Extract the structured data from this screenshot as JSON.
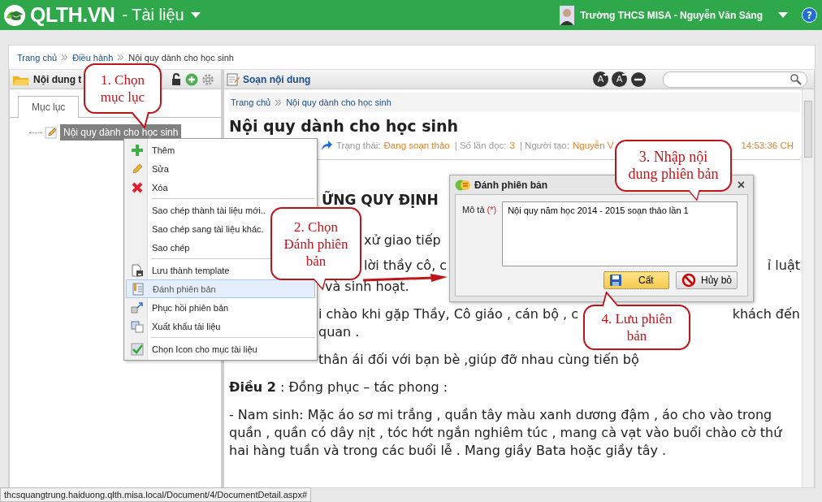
{
  "header": {
    "logo": "QLTH.VN",
    "module": "- Tài liệu",
    "user": "Trường THCS MISA - Nguyễn Văn Sáng",
    "help": "?"
  },
  "breadcrumb": [
    "Trang chủ",
    "Điều hành",
    "Nội quy dành cho học sinh"
  ],
  "left_panel": {
    "title": "Nội dung t",
    "tabs": [
      {
        "label": "Mục lục",
        "selected": true
      }
    ],
    "tree": [
      {
        "label": "Nội quy dành cho học sinh",
        "selected": true
      }
    ]
  },
  "toolbar": {
    "title": "Soạn nội dung",
    "font_buttons": [
      {
        "label": "A",
        "kind": "increase"
      },
      {
        "label": "A",
        "kind": "decrease"
      }
    ]
  },
  "document": {
    "breadcrumb": [
      "Trang chủ",
      "Nội quy dành cho học sinh"
    ],
    "title": "Nội quy dành cho học sinh",
    "meta": [
      {
        "label": "Trạng thái:",
        "value": "Đang soạn thảo"
      },
      {
        "label": "| Số lần đọc:",
        "value": "3"
      },
      {
        "label": "| Người tạo:",
        "value": "Nguyễn V"
      }
    ],
    "meta_time": "14:53:36 CH",
    "lines": [
      {
        "kind": "heading",
        "segments": [
          "ỮNG QUY ĐỊNH"
        ]
      },
      {
        "kind": "para",
        "segments": [
          "xử giao tiếp"
        ]
      },
      {
        "kind": "para",
        "segments": [
          "lời thầy cô, c",
          "ỉ luật"
        ]
      },
      {
        "kind": "cont",
        "segments": [
          "và sinh hoạt."
        ]
      },
      {
        "kind": "para",
        "segments": [
          "i chào khi gặp Thầy, Cô giáo , cán bộ , c",
          "khách đến"
        ]
      },
      {
        "kind": "cont",
        "segments": [
          "quan ."
        ]
      },
      {
        "kind": "para",
        "segments": [
          "thân ái đối với bạn bè ,giúp đỡ nhau cùng tiến bộ"
        ]
      },
      {
        "kind": "para",
        "segments": [
          "**Điều 2** : Đồng phục – tác phong :"
        ]
      },
      {
        "kind": "para",
        "segments": [
          "- Nam sinh:  Mặc áo sơ mi trắng , quần tây màu xanh dương đậm , áo cho vào trong quần , quần có dây nịt , tóc hớt ngắn nghiêm túc , mang cà vạt vào buổi chào cờ thứ hai hàng tuần và trong các buổi lễ . Mang giầy Bata hoặc giầy tây ."
        ]
      }
    ]
  },
  "context_menu": [
    {
      "label": "Thêm",
      "kind": "plus",
      "divider_before": false,
      "selected": false
    },
    {
      "label": "Sửa",
      "kind": "pencil",
      "divider_before": false,
      "selected": false
    },
    {
      "label": "Xóa",
      "kind": "cross",
      "divider_before": false,
      "selected": false
    },
    {
      "label": "Sao chép thành tài liệu mới..",
      "kind": "text",
      "divider_before": true,
      "selected": false
    },
    {
      "label": "Sao chép sang tài liệu khác.",
      "kind": "text",
      "divider_before": false,
      "selected": false
    },
    {
      "label": "Sao chép",
      "kind": "text",
      "divider_before": false,
      "selected": false
    },
    {
      "label": "Lưu thành template",
      "kind": "save",
      "divider_before": true,
      "selected": false
    },
    {
      "label": "Đánh phiên bản",
      "kind": "book",
      "divider_before": false,
      "selected": true
    },
    {
      "label": "Phục hồi phiên bản",
      "kind": "restore",
      "divider_before": false,
      "selected": false
    },
    {
      "label": "Xuất khẩu tài liệu",
      "kind": "export",
      "divider_before": false,
      "selected": false
    },
    {
      "label": "Chọn Icon cho mục tài liệu",
      "kind": "check",
      "divider_before": true,
      "selected": false
    }
  ],
  "dialog": {
    "title": "Đánh phiên bản",
    "close": "×",
    "field_label": "Mô tả",
    "required": "(*)",
    "value": "Nội quy năm học 2014 - 2015 soạn thảo lần 1",
    "buttons": [
      {
        "label": "Cất",
        "kind": "save",
        "selected": true
      },
      {
        "label": "Hủy bỏ",
        "kind": "cancel",
        "selected": false
      }
    ]
  },
  "callouts": [
    {
      "text": "1. Chọn mục lục"
    },
    {
      "text": "2. Chọn Đánh phiên bản"
    },
    {
      "text": "3. Nhập nội dung phiên bản"
    },
    {
      "text": "4. Lưu phiên bản"
    }
  ],
  "status_bar": "thcsquangtrung.haiduong.qlth.misa.local/Document/4/DocumentDetail.aspx#"
}
